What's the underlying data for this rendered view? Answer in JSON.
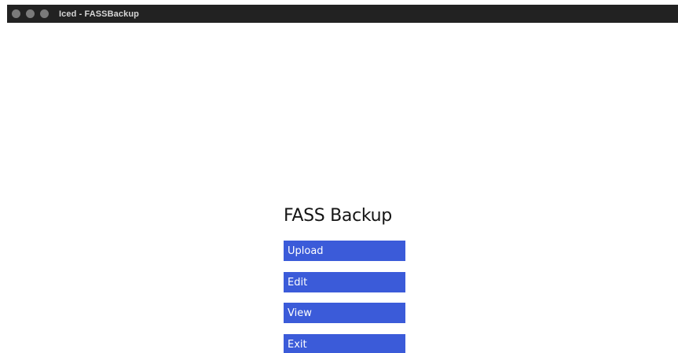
{
  "window": {
    "title": "Iced - FASSBackup"
  },
  "main": {
    "heading": "FASS Backup",
    "buttons": {
      "upload": "Upload",
      "edit": "Edit",
      "view": "View",
      "exit": "Exit"
    }
  },
  "colors": {
    "titlebar": "#222222",
    "button_bg": "#3b5bd9",
    "button_text": "#ffffff",
    "heading": "#151515"
  },
  "icons": {
    "window_controls": [
      "close-icon",
      "minimize-icon",
      "maximize-icon"
    ]
  }
}
